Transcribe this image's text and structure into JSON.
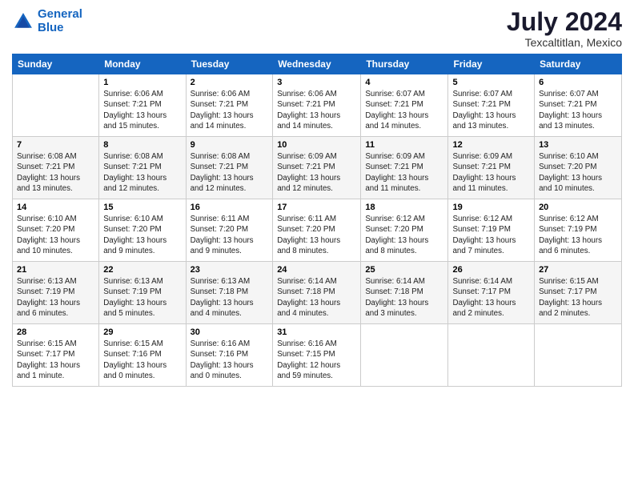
{
  "header": {
    "logo_line1": "General",
    "logo_line2": "Blue",
    "title": "July 2024",
    "subtitle": "Texcaltitlan, Mexico"
  },
  "weekdays": [
    "Sunday",
    "Monday",
    "Tuesday",
    "Wednesday",
    "Thursday",
    "Friday",
    "Saturday"
  ],
  "weeks": [
    [
      {
        "day": "",
        "info": ""
      },
      {
        "day": "1",
        "info": "Sunrise: 6:06 AM\nSunset: 7:21 PM\nDaylight: 13 hours\nand 15 minutes."
      },
      {
        "day": "2",
        "info": "Sunrise: 6:06 AM\nSunset: 7:21 PM\nDaylight: 13 hours\nand 14 minutes."
      },
      {
        "day": "3",
        "info": "Sunrise: 6:06 AM\nSunset: 7:21 PM\nDaylight: 13 hours\nand 14 minutes."
      },
      {
        "day": "4",
        "info": "Sunrise: 6:07 AM\nSunset: 7:21 PM\nDaylight: 13 hours\nand 14 minutes."
      },
      {
        "day": "5",
        "info": "Sunrise: 6:07 AM\nSunset: 7:21 PM\nDaylight: 13 hours\nand 13 minutes."
      },
      {
        "day": "6",
        "info": "Sunrise: 6:07 AM\nSunset: 7:21 PM\nDaylight: 13 hours\nand 13 minutes."
      }
    ],
    [
      {
        "day": "7",
        "info": "Sunrise: 6:08 AM\nSunset: 7:21 PM\nDaylight: 13 hours\nand 13 minutes."
      },
      {
        "day": "8",
        "info": "Sunrise: 6:08 AM\nSunset: 7:21 PM\nDaylight: 13 hours\nand 12 minutes."
      },
      {
        "day": "9",
        "info": "Sunrise: 6:08 AM\nSunset: 7:21 PM\nDaylight: 13 hours\nand 12 minutes."
      },
      {
        "day": "10",
        "info": "Sunrise: 6:09 AM\nSunset: 7:21 PM\nDaylight: 13 hours\nand 12 minutes."
      },
      {
        "day": "11",
        "info": "Sunrise: 6:09 AM\nSunset: 7:21 PM\nDaylight: 13 hours\nand 11 minutes."
      },
      {
        "day": "12",
        "info": "Sunrise: 6:09 AM\nSunset: 7:21 PM\nDaylight: 13 hours\nand 11 minutes."
      },
      {
        "day": "13",
        "info": "Sunrise: 6:10 AM\nSunset: 7:20 PM\nDaylight: 13 hours\nand 10 minutes."
      }
    ],
    [
      {
        "day": "14",
        "info": "Sunrise: 6:10 AM\nSunset: 7:20 PM\nDaylight: 13 hours\nand 10 minutes."
      },
      {
        "day": "15",
        "info": "Sunrise: 6:10 AM\nSunset: 7:20 PM\nDaylight: 13 hours\nand 9 minutes."
      },
      {
        "day": "16",
        "info": "Sunrise: 6:11 AM\nSunset: 7:20 PM\nDaylight: 13 hours\nand 9 minutes."
      },
      {
        "day": "17",
        "info": "Sunrise: 6:11 AM\nSunset: 7:20 PM\nDaylight: 13 hours\nand 8 minutes."
      },
      {
        "day": "18",
        "info": "Sunrise: 6:12 AM\nSunset: 7:20 PM\nDaylight: 13 hours\nand 8 minutes."
      },
      {
        "day": "19",
        "info": "Sunrise: 6:12 AM\nSunset: 7:19 PM\nDaylight: 13 hours\nand 7 minutes."
      },
      {
        "day": "20",
        "info": "Sunrise: 6:12 AM\nSunset: 7:19 PM\nDaylight: 13 hours\nand 6 minutes."
      }
    ],
    [
      {
        "day": "21",
        "info": "Sunrise: 6:13 AM\nSunset: 7:19 PM\nDaylight: 13 hours\nand 6 minutes."
      },
      {
        "day": "22",
        "info": "Sunrise: 6:13 AM\nSunset: 7:19 PM\nDaylight: 13 hours\nand 5 minutes."
      },
      {
        "day": "23",
        "info": "Sunrise: 6:13 AM\nSunset: 7:18 PM\nDaylight: 13 hours\nand 4 minutes."
      },
      {
        "day": "24",
        "info": "Sunrise: 6:14 AM\nSunset: 7:18 PM\nDaylight: 13 hours\nand 4 minutes."
      },
      {
        "day": "25",
        "info": "Sunrise: 6:14 AM\nSunset: 7:18 PM\nDaylight: 13 hours\nand 3 minutes."
      },
      {
        "day": "26",
        "info": "Sunrise: 6:14 AM\nSunset: 7:17 PM\nDaylight: 13 hours\nand 2 minutes."
      },
      {
        "day": "27",
        "info": "Sunrise: 6:15 AM\nSunset: 7:17 PM\nDaylight: 13 hours\nand 2 minutes."
      }
    ],
    [
      {
        "day": "28",
        "info": "Sunrise: 6:15 AM\nSunset: 7:17 PM\nDaylight: 13 hours\nand 1 minute."
      },
      {
        "day": "29",
        "info": "Sunrise: 6:15 AM\nSunset: 7:16 PM\nDaylight: 13 hours\nand 0 minutes."
      },
      {
        "day": "30",
        "info": "Sunrise: 6:16 AM\nSunset: 7:16 PM\nDaylight: 13 hours\nand 0 minutes."
      },
      {
        "day": "31",
        "info": "Sunrise: 6:16 AM\nSunset: 7:15 PM\nDaylight: 12 hours\nand 59 minutes."
      },
      {
        "day": "",
        "info": ""
      },
      {
        "day": "",
        "info": ""
      },
      {
        "day": "",
        "info": ""
      }
    ]
  ]
}
